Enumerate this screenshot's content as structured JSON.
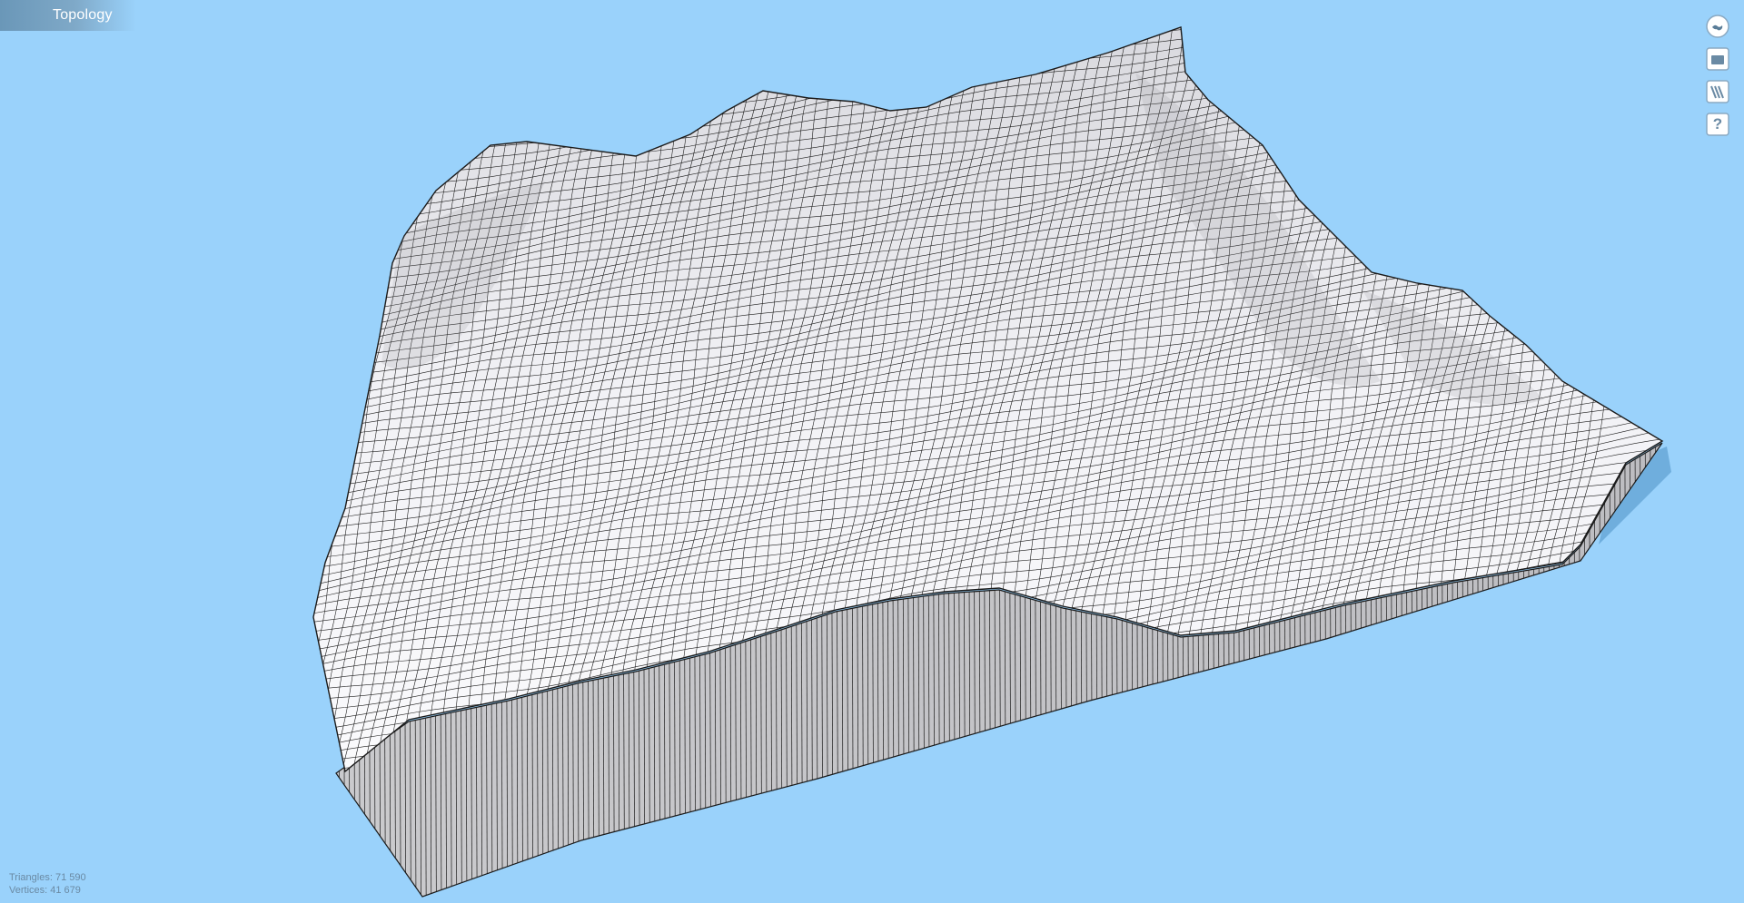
{
  "app": {
    "title": "Topology"
  },
  "toolbar": {
    "buttons": [
      {
        "name": "world-icon",
        "label": ""
      },
      {
        "name": "panel-icon",
        "label": ""
      },
      {
        "name": "wireframe-icon",
        "label": ""
      },
      {
        "name": "help-icon",
        "label": "?"
      }
    ]
  },
  "viewport": {
    "model": "terrain-mesh",
    "render_mode": "wireframe"
  },
  "stats": {
    "triangles": "Triangles: 71 590",
    "vertices": "Vertices: 41 679"
  },
  "colors": {
    "background": "#9ad2fb",
    "mesh_fill": "#eeeef2",
    "mesh_line": "#1b1b1b",
    "wall": "#c5c5c8",
    "shadow": "#4d8fc4"
  }
}
